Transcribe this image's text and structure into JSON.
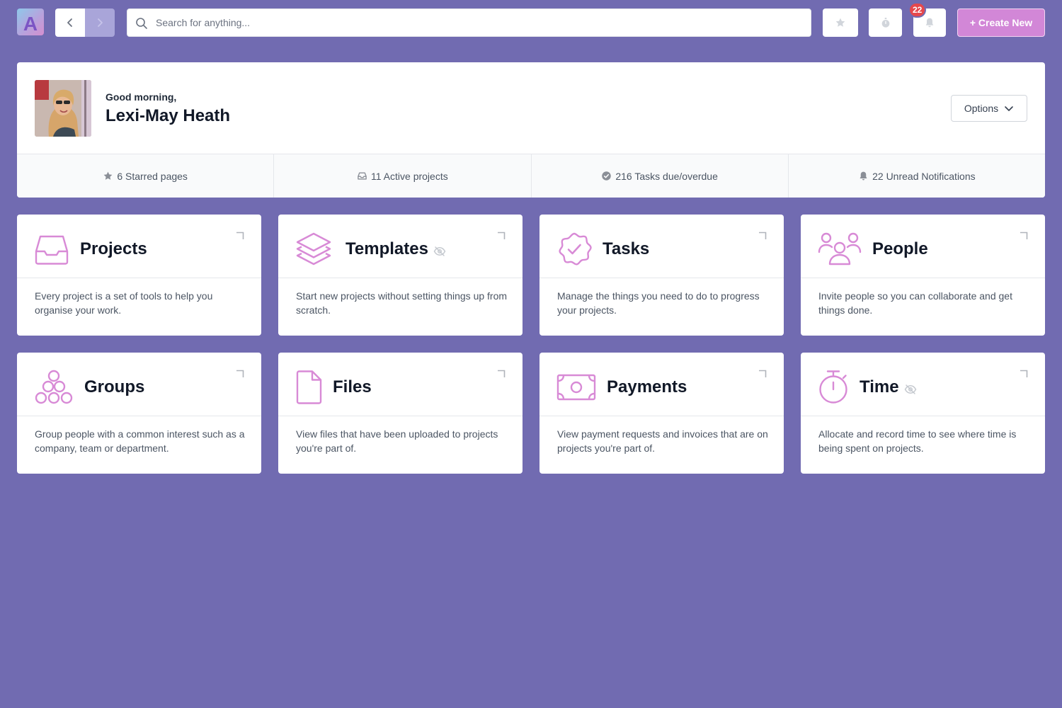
{
  "topbar": {
    "logo_letter": "A",
    "search_placeholder": "Search for anything...",
    "notification_count": "22",
    "create_label": "+ Create New"
  },
  "profile": {
    "greeting": "Good morning,",
    "name": "Lexi-May Heath",
    "options_label": "Options"
  },
  "stats": [
    {
      "icon": "star-icon",
      "label": "6 Starred pages"
    },
    {
      "icon": "inbox-icon",
      "label": "11 Active projects"
    },
    {
      "icon": "check-badge-icon",
      "label": "216 Tasks due/overdue"
    },
    {
      "icon": "bell-icon",
      "label": "22 Unread Notifications"
    }
  ],
  "cards": [
    {
      "icon": "inbox-icon",
      "title": "Projects",
      "hidden": false,
      "desc": "Every project is a set of tools to help you organise your work."
    },
    {
      "icon": "layers-icon",
      "title": "Templates",
      "hidden": true,
      "desc": "Start new projects without setting things up from scratch."
    },
    {
      "icon": "check-badge-icon",
      "title": "Tasks",
      "hidden": false,
      "desc": "Manage the things you need to do to progress your projects."
    },
    {
      "icon": "users-icon",
      "title": "People",
      "hidden": false,
      "desc": "Invite people so you can collaborate and get things done."
    },
    {
      "icon": "circles-icon",
      "title": "Groups",
      "hidden": false,
      "desc": "Group people with a common interest such as a company, team or department."
    },
    {
      "icon": "file-icon",
      "title": "Files",
      "hidden": false,
      "desc": "View files that have been uploaded to projects you're part of."
    },
    {
      "icon": "banknote-icon",
      "title": "Payments",
      "hidden": false,
      "desc": "View payment requests and invoices that are on projects you're part of."
    },
    {
      "icon": "stopwatch-icon",
      "title": "Time",
      "hidden": true,
      "desc": "Allocate and record time to see where time is being spent on projects."
    }
  ],
  "colors": {
    "background": "#716bb1",
    "accent": "#d287d7",
    "icon_accent": "#d88ad6",
    "badge": "#e5484d"
  }
}
